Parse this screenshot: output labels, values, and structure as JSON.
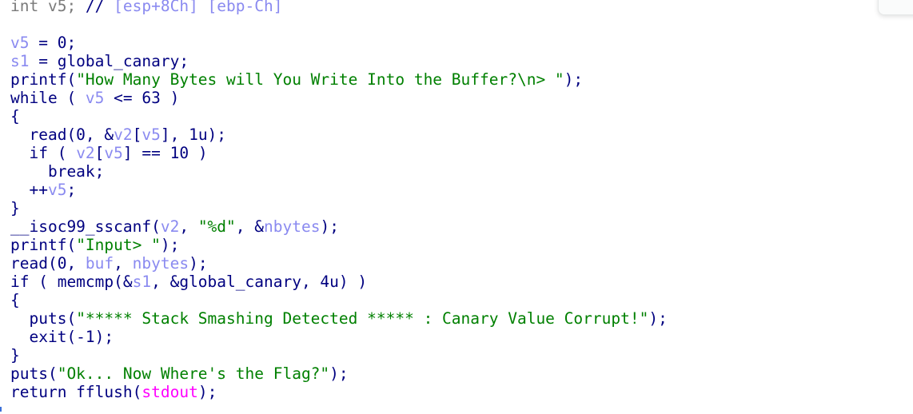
{
  "pseudocode": {
    "lines": [
      [
        {
          "t": "int v5; ",
          "c": "decl"
        },
        {
          "t": "// ",
          "c": "cm"
        },
        {
          "t": "[esp+8Ch] [ebp-Ch]",
          "c": "addr"
        }
      ],
      [],
      [
        {
          "t": "v5",
          "c": "var"
        },
        {
          "t": " = 0;",
          "c": "kw"
        }
      ],
      [
        {
          "t": "s1",
          "c": "var"
        },
        {
          "t": " = global_canary;",
          "c": "kw"
        }
      ],
      [
        {
          "t": "printf(",
          "c": "kw"
        },
        {
          "t": "\"How Many Bytes will You Write Into the Buffer?\\n> \"",
          "c": "str"
        },
        {
          "t": ");",
          "c": "kw"
        }
      ],
      [
        {
          "t": "while ( ",
          "c": "kw"
        },
        {
          "t": "v5",
          "c": "var"
        },
        {
          "t": " <= 63 )",
          "c": "kw"
        }
      ],
      [
        {
          "t": "{",
          "c": "kw"
        }
      ],
      [
        {
          "t": "  read(0, &",
          "c": "kw"
        },
        {
          "t": "v2",
          "c": "var"
        },
        {
          "t": "[",
          "c": "kw"
        },
        {
          "t": "v5",
          "c": "var"
        },
        {
          "t": "], 1u);",
          "c": "kw"
        }
      ],
      [
        {
          "t": "  if ( ",
          "c": "kw"
        },
        {
          "t": "v2",
          "c": "var"
        },
        {
          "t": "[",
          "c": "kw"
        },
        {
          "t": "v5",
          "c": "var"
        },
        {
          "t": "] == 10 )",
          "c": "kw"
        }
      ],
      [
        {
          "t": "    break;",
          "c": "kw"
        }
      ],
      [
        {
          "t": "  ++",
          "c": "kw"
        },
        {
          "t": "v5",
          "c": "var"
        },
        {
          "t": ";",
          "c": "kw"
        }
      ],
      [
        {
          "t": "}",
          "c": "kw"
        }
      ],
      [
        {
          "t": "__isoc99_sscanf(",
          "c": "kw"
        },
        {
          "t": "v2",
          "c": "var"
        },
        {
          "t": ", ",
          "c": "kw"
        },
        {
          "t": "\"%d\"",
          "c": "str"
        },
        {
          "t": ", &",
          "c": "kw"
        },
        {
          "t": "nbytes",
          "c": "var"
        },
        {
          "t": ");",
          "c": "kw"
        }
      ],
      [
        {
          "t": "printf(",
          "c": "kw"
        },
        {
          "t": "\"Input> \"",
          "c": "str"
        },
        {
          "t": ");",
          "c": "kw"
        }
      ],
      [
        {
          "t": "read(0, ",
          "c": "kw"
        },
        {
          "t": "buf",
          "c": "var"
        },
        {
          "t": ", ",
          "c": "kw"
        },
        {
          "t": "nbytes",
          "c": "var"
        },
        {
          "t": ");",
          "c": "kw"
        }
      ],
      [
        {
          "t": "if ( memcmp(&",
          "c": "kw"
        },
        {
          "t": "s1",
          "c": "var"
        },
        {
          "t": ", &global_canary, 4u) )",
          "c": "kw"
        }
      ],
      [
        {
          "t": "{",
          "c": "kw"
        }
      ],
      [
        {
          "t": "  puts(",
          "c": "kw"
        },
        {
          "t": "\"***** Stack Smashing Detected ***** : Canary Value Corrupt!\"",
          "c": "str"
        },
        {
          "t": ");",
          "c": "kw"
        }
      ],
      [
        {
          "t": "  exit(-1);",
          "c": "kw"
        }
      ],
      [
        {
          "t": "}",
          "c": "kw"
        }
      ],
      [
        {
          "t": "puts(",
          "c": "kw"
        },
        {
          "t": "\"Ok... Now Where's the Flag?\"",
          "c": "str"
        },
        {
          "t": ");",
          "c": "kw"
        }
      ],
      [
        {
          "t": "return fflush(",
          "c": "kw"
        },
        {
          "t": "stdout",
          "c": "imp"
        },
        {
          "t": ");",
          "c": "kw"
        }
      ]
    ]
  },
  "colors": {
    "keyword": "#000080",
    "variable": "#8a8af0",
    "string": "#008000",
    "import": "#ff00ff",
    "comment_gray": "#7a7a7a"
  }
}
